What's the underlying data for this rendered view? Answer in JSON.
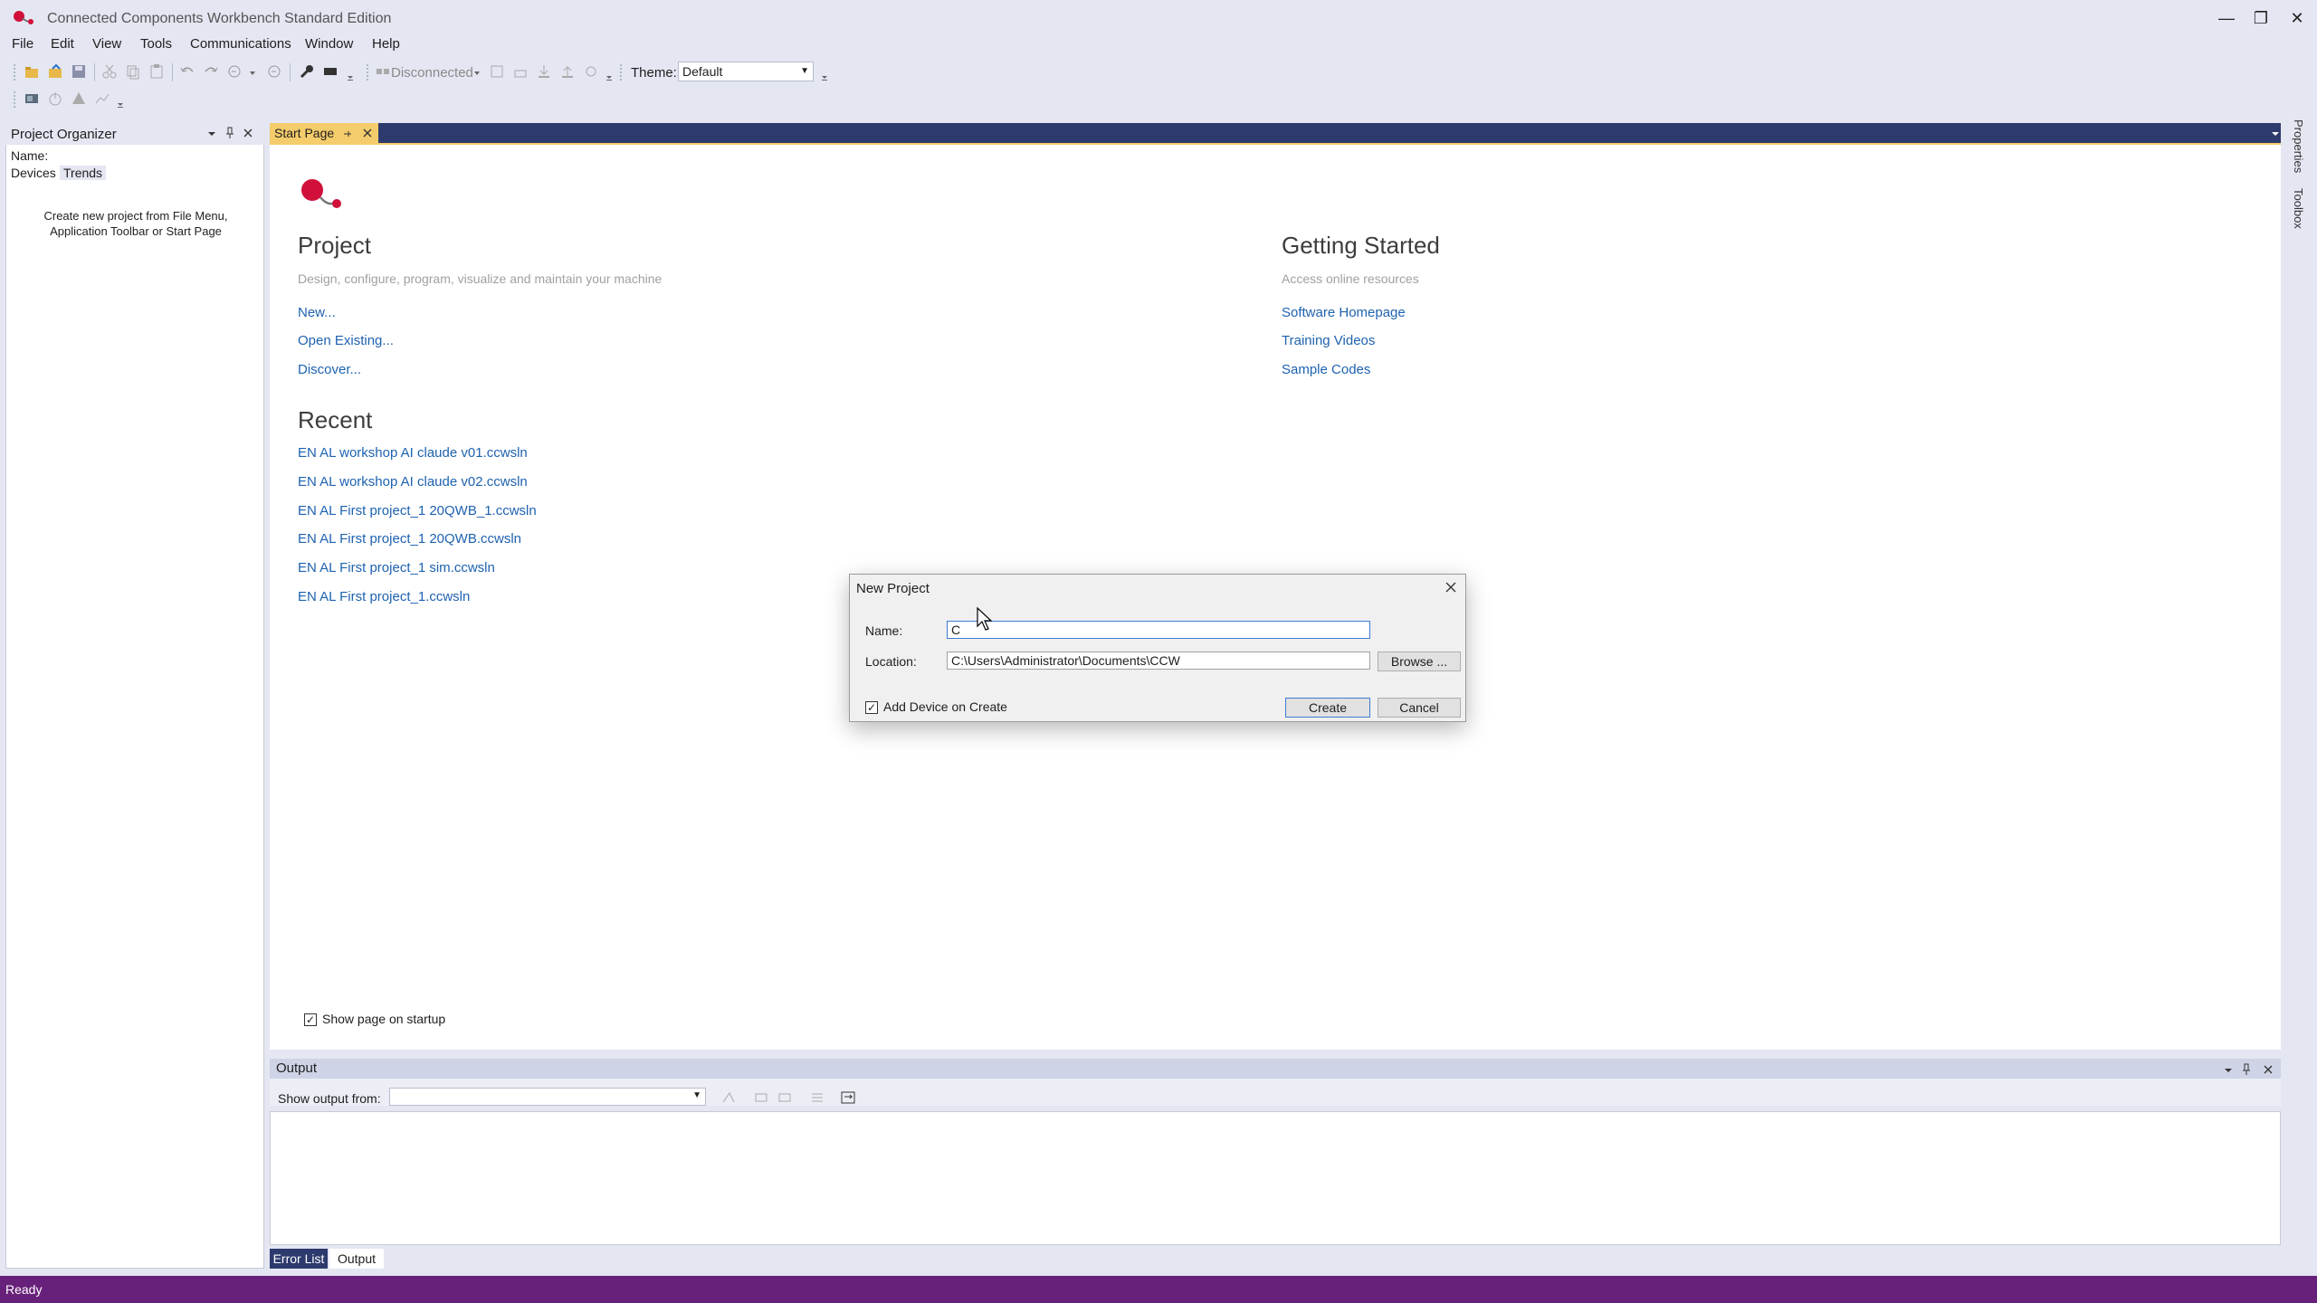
{
  "app": {
    "title": "Connected Components Workbench Standard Edition"
  },
  "window_controls": {
    "minimize": "—",
    "restore": "❐",
    "close": "✕"
  },
  "menu": [
    "File",
    "Edit",
    "View",
    "Tools",
    "Communications",
    "Window",
    "Help"
  ],
  "toolbar": {
    "connection_status": "Disconnected",
    "theme_label": "Theme:",
    "theme_value": "Default"
  },
  "project_organizer": {
    "title": "Project Organizer",
    "name_label": "Name:",
    "tabs": [
      "Devices",
      "Trends"
    ],
    "hint_line1": "Create new project from File Menu,",
    "hint_line2": "Application Toolbar or Start Page"
  },
  "doc_tab": {
    "label": "Start Page"
  },
  "start_page": {
    "project": {
      "heading": "Project",
      "subtitle": "Design, configure, program, visualize and maintain your machine",
      "links": [
        "New...",
        "Open Existing...",
        "Discover..."
      ]
    },
    "getting_started": {
      "heading": "Getting Started",
      "subtitle": "Access online resources",
      "links": [
        "Software Homepage",
        "Training Videos",
        "Sample Codes"
      ]
    },
    "recent": {
      "heading": "Recent",
      "items": [
        "EN AL workshop AI claude v01.ccwsln",
        "EN AL workshop AI claude v02.ccwsln",
        "EN AL First project_1 20QWB_1.ccwsln",
        "EN AL First project_1 20QWB.ccwsln",
        "EN AL First project_1 sim.ccwsln",
        "EN AL First project_1.ccwsln"
      ]
    },
    "show_on_startup": "Show page on startup"
  },
  "side_tabs": [
    "Properties",
    "Toolbox"
  ],
  "output": {
    "title": "Output",
    "show_from_label": "Show output from:"
  },
  "bottom_tabs": [
    "Error List",
    "Output"
  ],
  "status": {
    "text": "Ready"
  },
  "dialog": {
    "title": "New Project",
    "name_label": "Name:",
    "name_value": "C",
    "location_label": "Location:",
    "location_value": "C:\\Users\\Administrator\\Documents\\CCW",
    "browse_label": "Browse ...",
    "add_device_label": "Add Device on Create",
    "create_label": "Create",
    "cancel_label": "Cancel"
  },
  "colors": {
    "accent_purple": "#68217a",
    "tab_yellow": "#f5cc6b",
    "tabbar_navy": "#2d3a6e",
    "link_blue": "#1e62b0",
    "logo_red": "#d0103a"
  }
}
